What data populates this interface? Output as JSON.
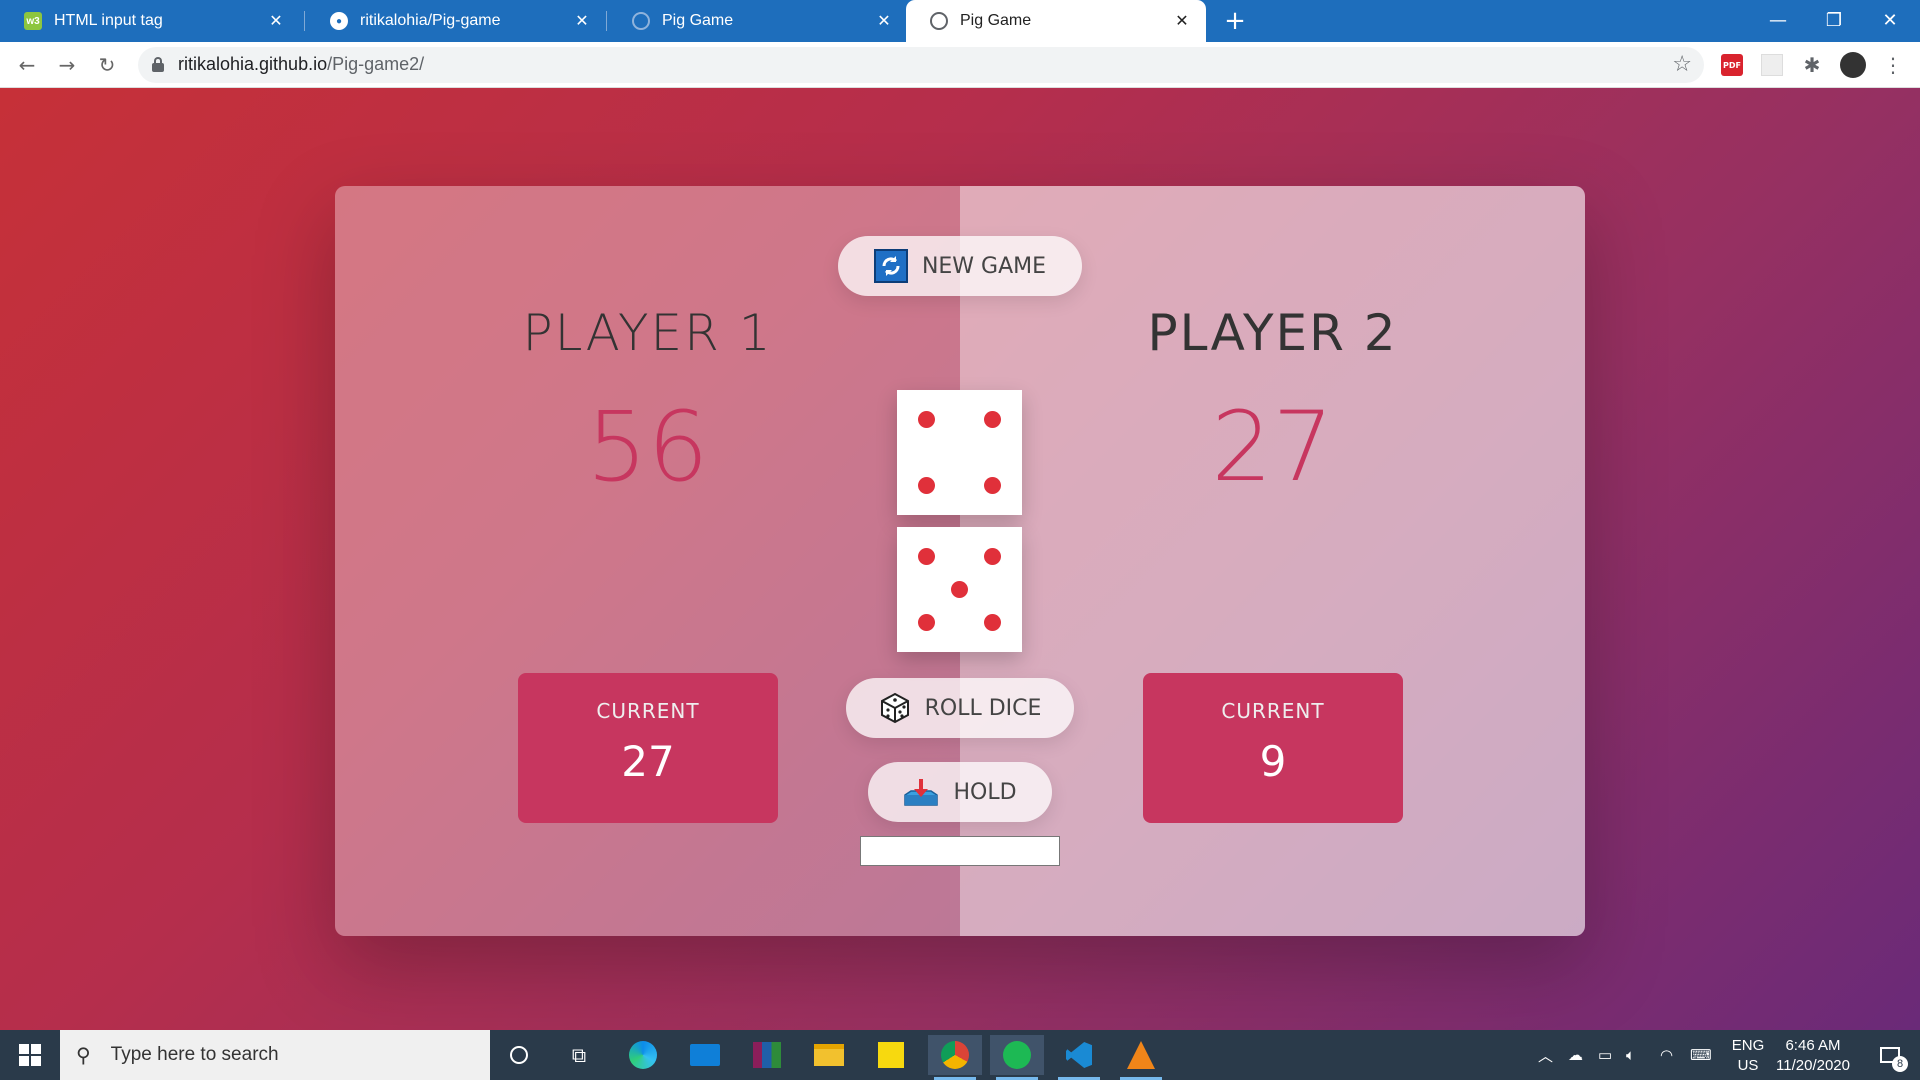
{
  "browser": {
    "tabs": [
      {
        "title": "HTML input tag",
        "icon": "w3schools-icon",
        "active": false
      },
      {
        "title": "ritikalohia/Pig-game",
        "icon": "github-icon",
        "active": false
      },
      {
        "title": "Pig Game",
        "icon": "globe-icon",
        "active": false
      },
      {
        "title": "Pig Game",
        "icon": "globe-icon",
        "active": true
      }
    ],
    "url_host": "ritikalohia.github.io",
    "url_path": "/Pig-game2/"
  },
  "game": {
    "new_game_label": "NEW GAME",
    "roll_dice_label": "ROLL DICE",
    "hold_label": "HOLD",
    "hold_input_value": "",
    "current_label": "CURRENT",
    "players": [
      {
        "name": "PLAYER 1",
        "score": "56",
        "current": "27"
      },
      {
        "name": "PLAYER 2",
        "score": "27",
        "current": "9"
      }
    ],
    "dice": [
      4,
      5
    ]
  },
  "taskbar": {
    "search_placeholder": "Type here to search",
    "lang_line1": "ENG",
    "lang_line2": "US",
    "time": "6:46 AM",
    "date": "11/20/2020",
    "notification_count": "8"
  },
  "colors": {
    "accent": "#c7365f",
    "pip": "#e0303a",
    "tabstrip": "#1e6ebc"
  }
}
